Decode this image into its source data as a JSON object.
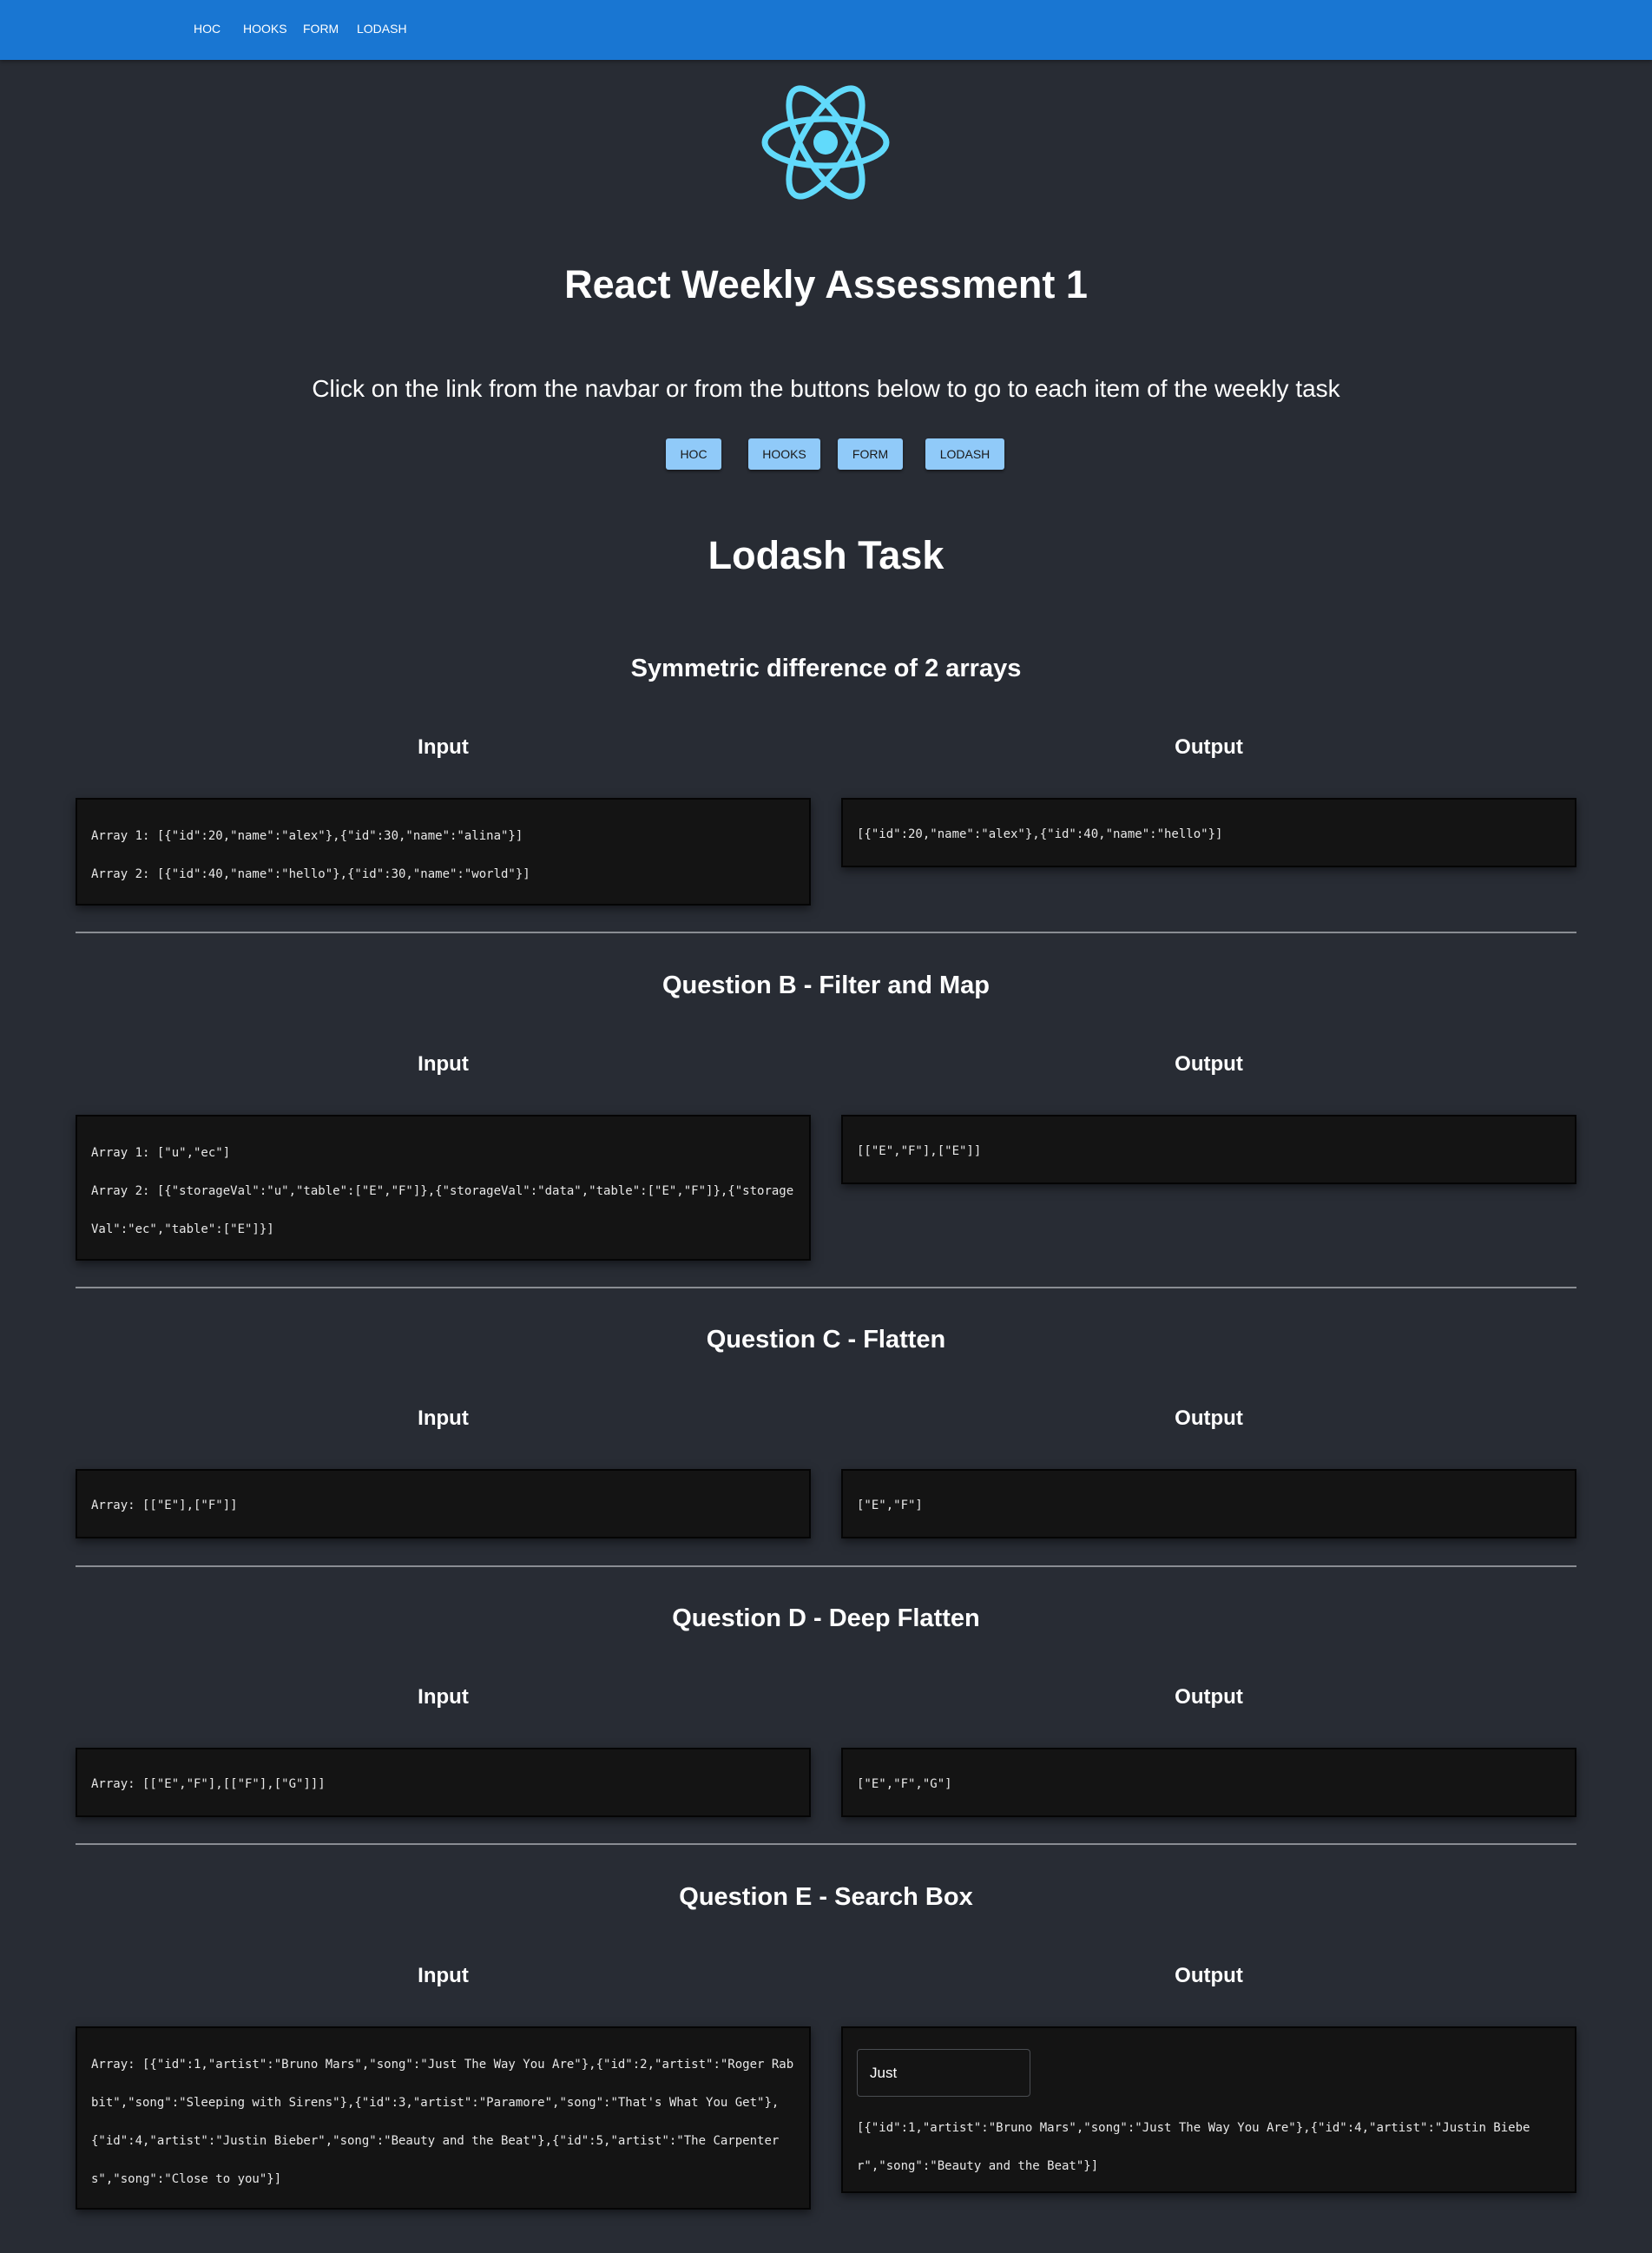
{
  "nav": {
    "links": [
      {
        "label": "HOC"
      },
      {
        "label": "HOOKS"
      },
      {
        "label": "FORM"
      },
      {
        "label": "LODASH"
      }
    ]
  },
  "header": {
    "title": "React Weekly Assessment 1",
    "subtitle": "Click on the link from the navbar or from the buttons below to go to each item of the weekly task"
  },
  "buttons": [
    {
      "label": "HOC"
    },
    {
      "label": "HOOKS"
    },
    {
      "label": "FORM"
    },
    {
      "label": "LODASH"
    }
  ],
  "colors": {
    "navbar": "#1976d2",
    "background": "#282c34",
    "button": "#90caf9",
    "logo": "#61dafb",
    "box": "#141414"
  },
  "lodash": {
    "title": "Lodash Task",
    "input_label": "Input",
    "output_label": "Output",
    "questions": [
      {
        "title": "Symmetric difference of 2 arrays",
        "input_lines": [
          "Array 1: [{\"id\":20,\"name\":\"alex\"},{\"id\":30,\"name\":\"alina\"}]",
          "Array 2: [{\"id\":40,\"name\":\"hello\"},{\"id\":30,\"name\":\"world\"}]"
        ],
        "output": "[{\"id\":20,\"name\":\"alex\"},{\"id\":40,\"name\":\"hello\"}]"
      },
      {
        "title": "Question B - Filter and Map",
        "input_lines": [
          "Array 1: [\"u\",\"ec\"]",
          "Array 2: [{\"storageVal\":\"u\",\"table\":[\"E\",\"F\"]},{\"storageVal\":\"data\",\"table\":[\"E\",\"F\"]},{\"storageVal\":\"ec\",\"table\":[\"E\"]}]"
        ],
        "output": "[[\"E\",\"F\"],[\"E\"]]"
      },
      {
        "title": "Question C - Flatten",
        "input_lines": [
          "Array: [[\"E\"],[\"F\"]]"
        ],
        "output": "[\"E\",\"F\"]"
      },
      {
        "title": "Question D - Deep Flatten",
        "input_lines": [
          "Array: [[\"E\",\"F\"],[[\"F\"],[\"G\"]]]"
        ],
        "output": "[\"E\",\"F\",\"G\"]"
      },
      {
        "title": "Question E - Search Box",
        "input_lines": [
          "Array: [{\"id\":1,\"artist\":\"Bruno Mars\",\"song\":\"Just The Way You Are\"},{\"id\":2,\"artist\":\"Roger Rabbit\",\"song\":\"Sleeping with Sirens\"},{\"id\":3,\"artist\":\"Paramore\",\"song\":\"That's What You Get\"},{\"id\":4,\"artist\":\"Justin Bieber\",\"song\":\"Beauty and the Beat\"},{\"id\":5,\"artist\":\"The Carpenters\",\"song\":\"Close to you\"}]"
        ],
        "search_value": "Just",
        "output": "[{\"id\":1,\"artist\":\"Bruno Mars\",\"song\":\"Just The Way You Are\"},{\"id\":4,\"artist\":\"Justin Bieber\",\"song\":\"Beauty and the Beat\"}]"
      }
    ]
  }
}
